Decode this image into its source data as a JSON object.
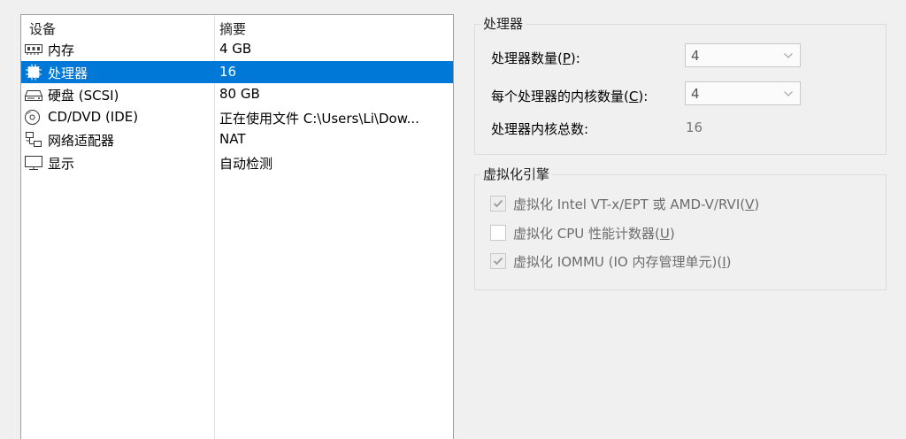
{
  "device_list": {
    "headers": {
      "device": "设备",
      "summary": "摘要"
    },
    "items": [
      {
        "name": "内存",
        "summary": "4 GB",
        "icon": "memory-icon"
      },
      {
        "name": "处理器",
        "summary": "16",
        "icon": "processor-icon",
        "selected": true
      },
      {
        "name": "硬盘 (SCSI)",
        "summary": "80 GB",
        "icon": "hard-disk-icon"
      },
      {
        "name": "CD/DVD (IDE)",
        "summary": "正在使用文件 C:\\Users\\Li\\Dow...",
        "icon": "cd-dvd-icon"
      },
      {
        "name": "网络适配器",
        "summary": "NAT",
        "icon": "network-adapter-icon"
      },
      {
        "name": "显示",
        "summary": "自动检测",
        "icon": "display-icon"
      }
    ]
  },
  "processor_group": {
    "title": "处理器",
    "count": {
      "label_prefix": "处理器数量(",
      "key": "P",
      "label_suffix": "):",
      "value": "4"
    },
    "cores": {
      "label_prefix": "每个处理器的内核数量(",
      "key": "C",
      "label_suffix": "):",
      "value": "4"
    },
    "total": {
      "label": "处理器内核总数:",
      "value": "16"
    }
  },
  "virtualization_group": {
    "title": "虚拟化引擎",
    "options": [
      {
        "label_prefix": "虚拟化 Intel VT-x/EPT 或 AMD-V/RVI(",
        "key": "V",
        "label_suffix": ")",
        "checked": true
      },
      {
        "label_prefix": "虚拟化 CPU 性能计数器(",
        "key": "U",
        "label_suffix": ")",
        "checked": false
      },
      {
        "label_prefix": "虚拟化 IOMMU (IO 内存管理单元)(",
        "key": "I",
        "label_suffix": ")",
        "checked": true
      }
    ]
  }
}
